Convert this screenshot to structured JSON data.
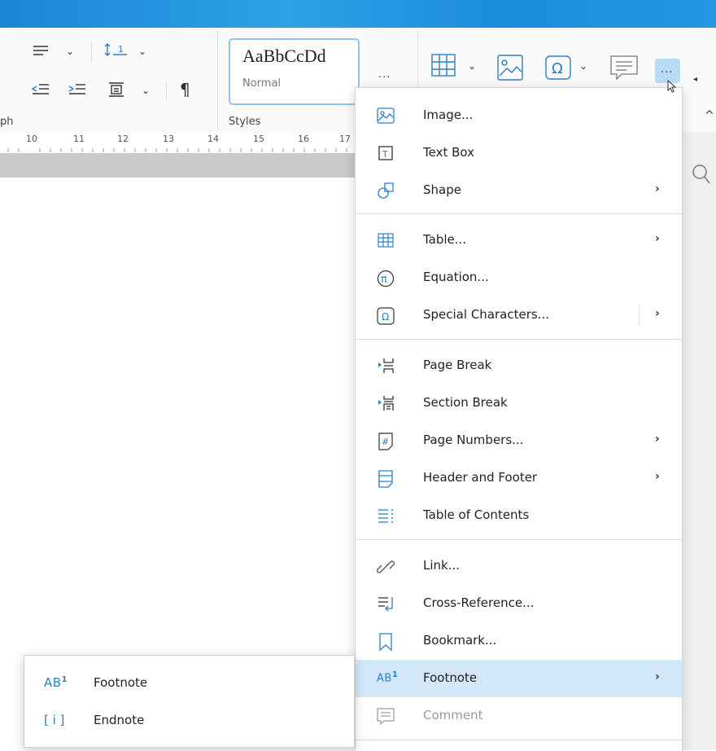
{
  "ribbon": {
    "group_paragraph_label": "ph",
    "group_styles_label": "Styles",
    "style_sample": "AaBbCcDd",
    "style_name": "Normal",
    "more_styles": "...",
    "more_insert": "...",
    "pilcrow": "¶"
  },
  "ruler": {
    "numbers": [
      "10",
      "11",
      "12",
      "13",
      "14",
      "15",
      "16",
      "17"
    ]
  },
  "insert_menu": {
    "items": [
      {
        "label": "Image...",
        "icon": "image-icon"
      },
      {
        "label": "Text Box",
        "icon": "text-box-icon"
      },
      {
        "label": "Shape",
        "icon": "shape-icon"
      },
      {
        "label": "Table...",
        "icon": "table-icon"
      },
      {
        "label": "Equation...",
        "icon": "equation-icon"
      },
      {
        "label": "Special Characters...",
        "icon": "omega-icon"
      },
      {
        "label": "Page Break",
        "icon": "page-break-icon"
      },
      {
        "label": "Section Break",
        "icon": "section-break-icon"
      },
      {
        "label": "Page Numbers...",
        "icon": "page-numbers-icon"
      },
      {
        "label": "Header and Footer",
        "icon": "header-footer-icon"
      },
      {
        "label": "Table of Contents",
        "icon": "toc-icon"
      },
      {
        "label": "Link...",
        "icon": "link-icon"
      },
      {
        "label": "Cross-Reference...",
        "icon": "cross-reference-icon"
      },
      {
        "label": "Bookmark...",
        "icon": "bookmark-icon"
      },
      {
        "label": "Footnote",
        "icon": "footnote-icon"
      },
      {
        "label": "Comment",
        "icon": "comment-icon"
      }
    ],
    "submenu_arrow": "›"
  },
  "footnote_submenu": {
    "items": [
      {
        "label": "Footnote",
        "icon": "footnote-icon"
      },
      {
        "label": "Endnote",
        "icon": "endnote-icon"
      }
    ]
  },
  "colors": {
    "accent": "#2b7fc4",
    "highlight": "#d2e7f8",
    "titlebar": "#1d8bdc"
  }
}
